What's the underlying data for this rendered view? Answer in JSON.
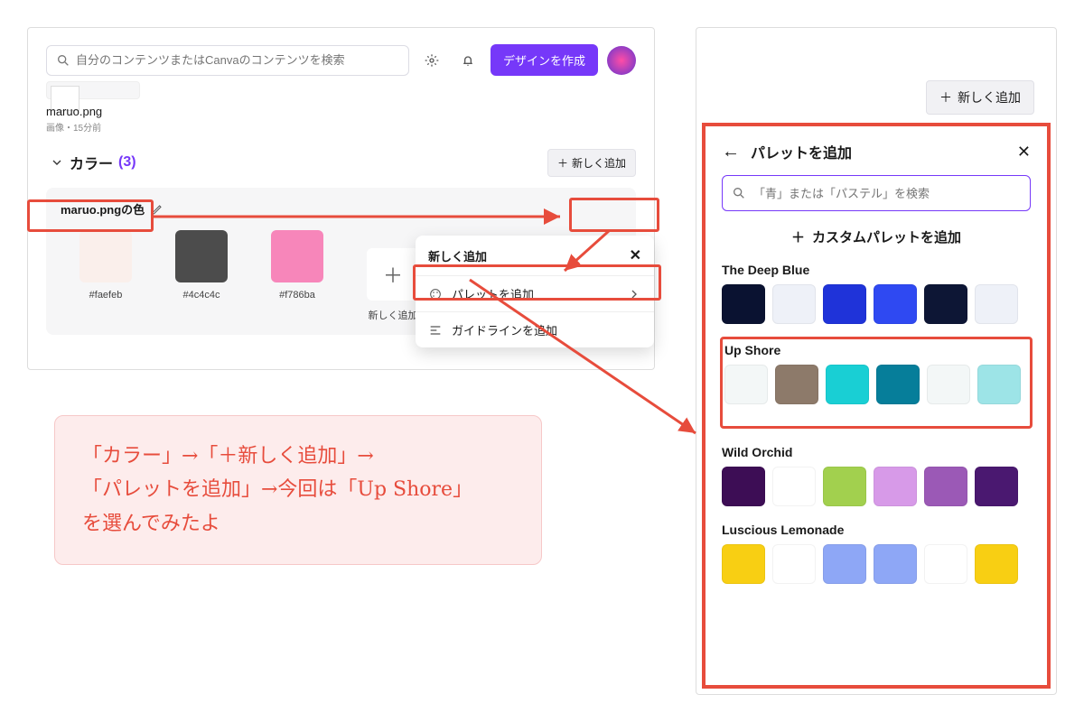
{
  "top": {
    "search_placeholder": "自分のコンテンツまたはCanvaのコンテンツを検索",
    "design_btn": "デザインを作成"
  },
  "file": {
    "name": "maruo.png",
    "meta": "画像・15分前"
  },
  "section": {
    "title": "カラー",
    "count": "(3)",
    "add": "新しく追加"
  },
  "palette_card": {
    "title": "maruo.pngの色",
    "swatches": [
      {
        "hex": "#faefeb"
      },
      {
        "hex": "#4c4c4c"
      },
      {
        "hex": "#f786ba"
      }
    ],
    "add_label": "新しく追加"
  },
  "dropdown": {
    "header": "新しく追加",
    "item_palette": "パレットを追加",
    "item_guideline": "ガイドラインを追加"
  },
  "right": {
    "new_btn": "新しく追加",
    "title": "パレットを追加",
    "search_placeholder": "「青」または「パステル」を検索",
    "custom_add": "カスタムパレットを追加",
    "groups": [
      {
        "name": "The Deep Blue",
        "colors": [
          "#0a1231",
          "#eef1f8",
          "#1f33d9",
          "#2f49f2",
          "#0d1635",
          "#eef1f8"
        ]
      },
      {
        "name": "Up Shore",
        "colors": [
          "#f3f7f7",
          "#8d7a6a",
          "#19cfd4",
          "#067e9a",
          "#f3f7f7",
          "#9de4e7"
        ]
      },
      {
        "name": "Wild Orchid",
        "colors": [
          "#3d0d55",
          "#ffffff",
          "#a2d04e",
          "#d79ae8",
          "#9b59b6",
          "#4a1870"
        ]
      },
      {
        "name": "Luscious Lemonade",
        "colors": [
          "#f8cf13",
          "#ffffff",
          "#8ea7f6",
          "#8ea7f6",
          "#ffffff",
          "#f8cf13"
        ]
      }
    ]
  },
  "annotation_lines": [
    "「カラー」→「＋新しく追加」→",
    "「パレットを追加」→今回は「Up Shore」",
    "を選んでみたよ"
  ]
}
